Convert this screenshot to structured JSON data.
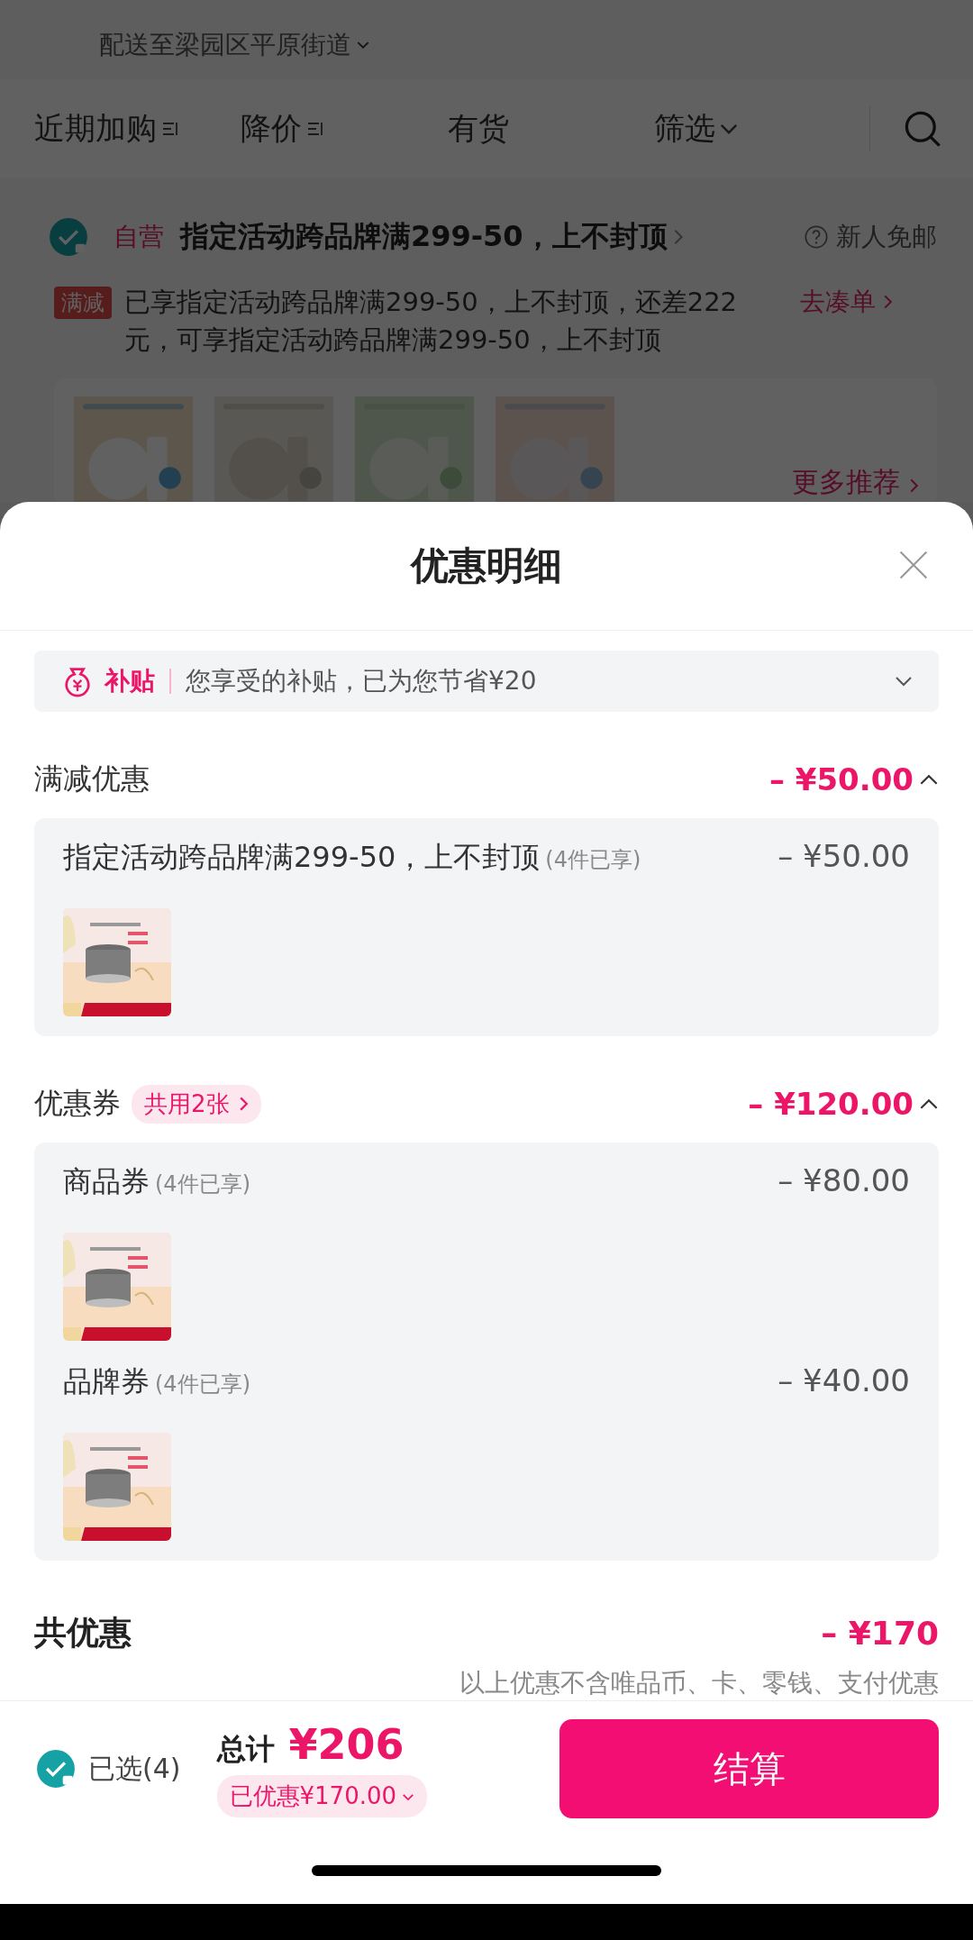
{
  "background": {
    "address": "配送至梁园区平原街道",
    "filters": [
      {
        "label": "近期加购",
        "kind": "sort"
      },
      {
        "label": "降价",
        "kind": "sort"
      },
      {
        "label": "有货",
        "kind": "plain"
      },
      {
        "label": "筛选",
        "kind": "dropdown"
      }
    ],
    "store": {
      "checked": true,
      "tag": "自营",
      "promo": "指定活动跨品牌满299-50，上不封顶",
      "shipping": "新人免邮"
    },
    "notice": {
      "tag": "满减",
      "text": "已享指定活动跨品牌满299-50，上不封顶，还差222元，可享指定活动跨品牌满299-50，上不封顶",
      "link": "去凑单"
    },
    "more": "更多推荐"
  },
  "sheet": {
    "title": "优惠明细",
    "subsidy": {
      "tag": "补贴",
      "text": "您享受的补贴，已为您节省¥20",
      "expanded": false
    },
    "sections": [
      {
        "title": "满减优惠",
        "amount": "– ¥50.00",
        "expanded": true,
        "items": [
          {
            "name": "指定活动跨品牌满299-50，上不封顶",
            "note": "(4件已享)",
            "amount": "– ¥50.00"
          }
        ]
      },
      {
        "title": "优惠券",
        "badge": "共用2张",
        "amount": "– ¥120.00",
        "expanded": true,
        "items": [
          {
            "name": "商品券",
            "note": "(4件已享)",
            "amount": "– ¥80.00"
          },
          {
            "name": "品牌券",
            "note": "(4件已享)",
            "amount": "– ¥40.00"
          }
        ]
      }
    ],
    "total": {
      "label": "共优惠",
      "amount": "– ¥170",
      "note": "以上优惠不含唯品币、卡、零钱、支付优惠"
    }
  },
  "footer": {
    "checked": true,
    "selected_label": "已选(4)",
    "total_label": "总计",
    "total": "¥206",
    "discount": "已优惠¥170.00",
    "checkout": "结算"
  }
}
